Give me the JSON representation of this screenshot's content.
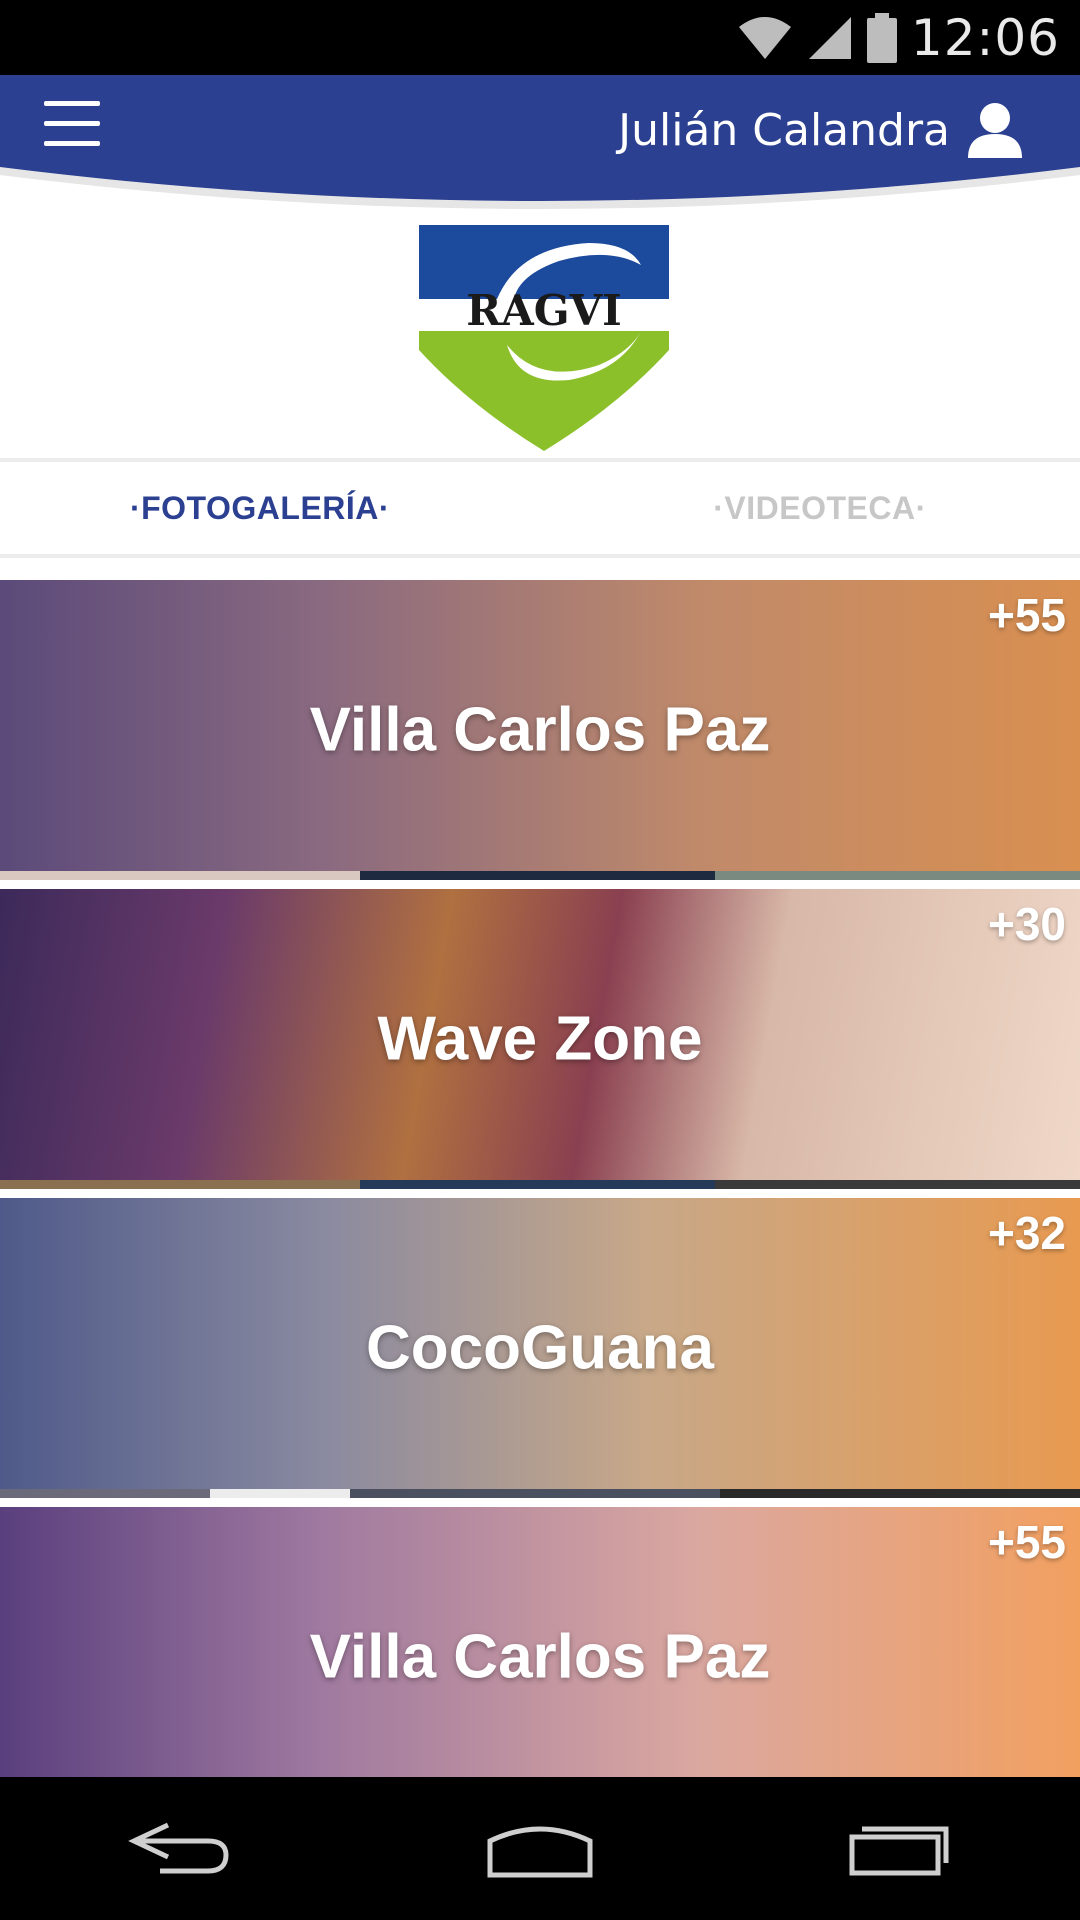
{
  "status_bar": {
    "time": "12:06",
    "icons": [
      "wifi-icon",
      "cell-signal-icon",
      "battery-icon"
    ]
  },
  "header": {
    "menu_icon": "hamburger-menu-icon",
    "user_name": "Julián Calandra",
    "user_icon": "user-icon",
    "color": "#2c4091"
  },
  "logo": {
    "text": "RAGVI",
    "top_color": "#1c4a9c",
    "bottom_color": "#8cc02b"
  },
  "tabs": [
    {
      "label": "·FOTOGALERÍA·",
      "active": true
    },
    {
      "label": "·VIDEOTECA·",
      "active": false
    }
  ],
  "gallery": [
    {
      "title": "Villa Carlos Paz",
      "count": "+55"
    },
    {
      "title": "Wave Zone",
      "count": "+30"
    },
    {
      "title": "CocoGuana",
      "count": "+32"
    },
    {
      "title": "Villa Carlos Paz",
      "count": "+55"
    }
  ],
  "nav_bar": {
    "icons": [
      "back-icon",
      "home-icon",
      "recent-apps-icon"
    ]
  }
}
